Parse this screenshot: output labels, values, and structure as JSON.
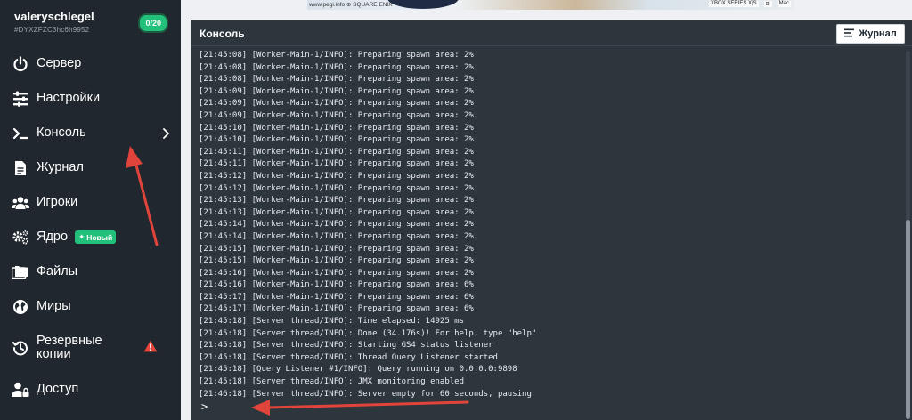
{
  "server": {
    "name": "valeryschlegel",
    "id": "#DYXZFZC3hc6h9952",
    "players": "0/20"
  },
  "sidebar": {
    "items": [
      {
        "label": "Сервер",
        "icon": "power-icon"
      },
      {
        "label": "Настройки",
        "icon": "sliders-icon"
      },
      {
        "label": "Консоль",
        "icon": "terminal-icon"
      },
      {
        "label": "Журнал",
        "icon": "file-icon"
      },
      {
        "label": "Игроки",
        "icon": "users-icon"
      },
      {
        "label": "Ядро",
        "icon": "cog-icon",
        "badge": "Новый"
      },
      {
        "label": "Файлы",
        "icon": "folder-icon"
      },
      {
        "label": "Миры",
        "icon": "globe-icon"
      },
      {
        "label": "Резервные копии",
        "label_line1": "Резервные",
        "label_line2": "копии",
        "icon": "history-icon"
      },
      {
        "label": "Доступ",
        "icon": "user-lock-icon"
      }
    ]
  },
  "ad": {
    "left_text": "www.pegi.info ⊕ SQUARE ENIX",
    "right_labels": [
      "XBOX SERIES X|S",
      "⊞",
      "Mac"
    ]
  },
  "console": {
    "title": "Консоль",
    "log_button_label": "Журнал",
    "prompt_symbol": ">",
    "lines": [
      "[21:45:08] [Worker-Main-1/INFO]: Preparing spawn area: 2%",
      "[21:45:08] [Worker-Main-1/INFO]: Preparing spawn area: 2%",
      "[21:45:08] [Worker-Main-1/INFO]: Preparing spawn area: 2%",
      "[21:45:09] [Worker-Main-1/INFO]: Preparing spawn area: 2%",
      "[21:45:09] [Worker-Main-1/INFO]: Preparing spawn area: 2%",
      "[21:45:09] [Worker-Main-1/INFO]: Preparing spawn area: 2%",
      "[21:45:10] [Worker-Main-1/INFO]: Preparing spawn area: 2%",
      "[21:45:10] [Worker-Main-1/INFO]: Preparing spawn area: 2%",
      "[21:45:11] [Worker-Main-1/INFO]: Preparing spawn area: 2%",
      "[21:45:11] [Worker-Main-1/INFO]: Preparing spawn area: 2%",
      "[21:45:12] [Worker-Main-1/INFO]: Preparing spawn area: 2%",
      "[21:45:12] [Worker-Main-1/INFO]: Preparing spawn area: 2%",
      "[21:45:13] [Worker-Main-1/INFO]: Preparing spawn area: 2%",
      "[21:45:13] [Worker-Main-1/INFO]: Preparing spawn area: 2%",
      "[21:45:14] [Worker-Main-1/INFO]: Preparing spawn area: 2%",
      "[21:45:14] [Worker-Main-1/INFO]: Preparing spawn area: 2%",
      "[21:45:15] [Worker-Main-1/INFO]: Preparing spawn area: 2%",
      "[21:45:15] [Worker-Main-1/INFO]: Preparing spawn area: 2%",
      "[21:45:16] [Worker-Main-1/INFO]: Preparing spawn area: 2%",
      "[21:45:16] [Worker-Main-1/INFO]: Preparing spawn area: 6%",
      "[21:45:17] [Worker-Main-1/INFO]: Preparing spawn area: 6%",
      "[21:45:17] [Worker-Main-1/INFO]: Preparing spawn area: 6%",
      "[21:45:18] [Server thread/INFO]: Time elapsed: 14925 ms",
      "[21:45:18] [Server thread/INFO]: Done (34.176s)! For help, type \"help\"",
      "[21:45:18] [Server thread/INFO]: Starting GS4 status listener",
      "[21:45:18] [Server thread/INFO]: Thread Query Listener started",
      "[21:45:18] [Query Listener #1/INFO]: Query running on 0.0.0.0:9898",
      "[21:45:18] [Server thread/INFO]: JMX monitoring enabled",
      "[21:46:18] [Server thread/INFO]: Server empty for 60 seconds, pausing"
    ]
  },
  "colors": {
    "sidebar_bg": "#20272e",
    "panel_bg": "#2d353d",
    "accent_green": "#22c07a",
    "annotation_red": "#e0443b",
    "warning_red": "#e8463c"
  }
}
